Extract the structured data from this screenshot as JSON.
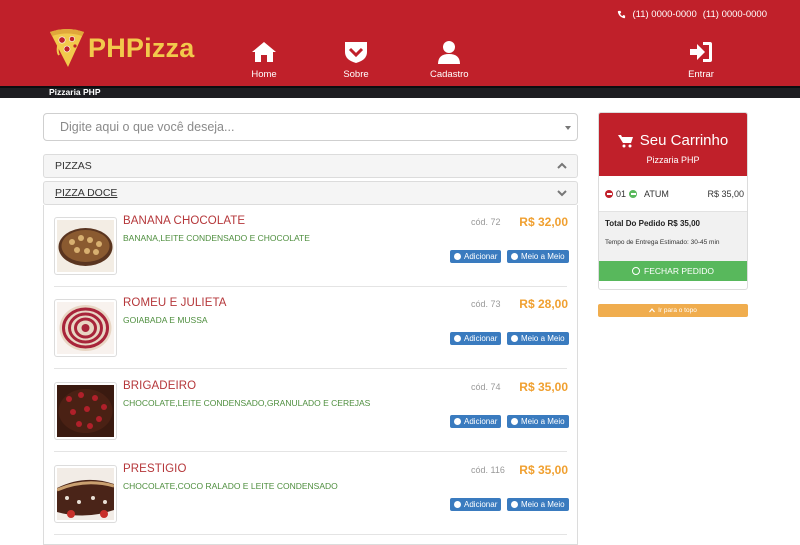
{
  "header": {
    "phone_1": "(11) 0000-0000",
    "phone_2": "(11) 0000-0000",
    "logo_text": "PHPizza",
    "nav": [
      {
        "label": "Home",
        "icon": "home-icon"
      },
      {
        "label": "Sobre",
        "icon": "shield-chevron-icon"
      },
      {
        "label": "Cadastro",
        "icon": "user-icon"
      },
      {
        "label": "Entrar",
        "icon": "sign-in-icon"
      }
    ],
    "subbar_text": "Pizzaria PHP"
  },
  "search": {
    "placeholder": "Digite aqui o que você deseja..."
  },
  "accordion": {
    "pizzas_label": "PIZZAS",
    "pizza_doce_label": "PIZZA DOCE"
  },
  "products": [
    {
      "name": "BANANA CHOCOLATE",
      "description": "BANANA,LEITE CONDENSADO E CHOCOLATE",
      "code": "cód. 72",
      "price": "R$ 32,00",
      "add_label": "Adicionar",
      "half_label": "Meio a Meio"
    },
    {
      "name": "ROMEU E JULIETA",
      "description": "GOIABADA E MUSSA",
      "code": "cód. 73",
      "price": "R$ 28,00",
      "add_label": "Adicionar",
      "half_label": "Meio a Meio"
    },
    {
      "name": "BRIGADEIRO",
      "description": "CHOCOLATE,LEITE CONDENSADO,GRANULADO E CEREJAS",
      "code": "cód. 74",
      "price": "R$ 35,00",
      "add_label": "Adicionar",
      "half_label": "Meio a Meio"
    },
    {
      "name": "PRESTIGIO",
      "description": "CHOCOLATE,COCO RALADO E LEITE CONDENSADO",
      "code": "cód. 116",
      "price": "R$ 35,00",
      "add_label": "Adicionar",
      "half_label": "Meio a Meio"
    }
  ],
  "cart": {
    "title": "Seu Carrinho",
    "subtitle": "Pizzaria PHP",
    "items": [
      {
        "qty": "01",
        "name": "ATUM",
        "price": "R$ 35,00"
      }
    ],
    "total_text": "Total Do Pedido R$ 35,00",
    "delivery_text": "Tempo de Entrega Estimado: 30-45 min",
    "checkout_label": "FECHAR PEDIDO"
  },
  "back_to_top_label": "Ir para o topo",
  "colors": {
    "brand_red": "#c0202a",
    "logo_yellow": "#f2c94c",
    "price_orange": "#f0a030",
    "button_blue": "#3a7bbf",
    "checkout_green": "#58b85c",
    "totop_orange": "#f0ad4e"
  }
}
